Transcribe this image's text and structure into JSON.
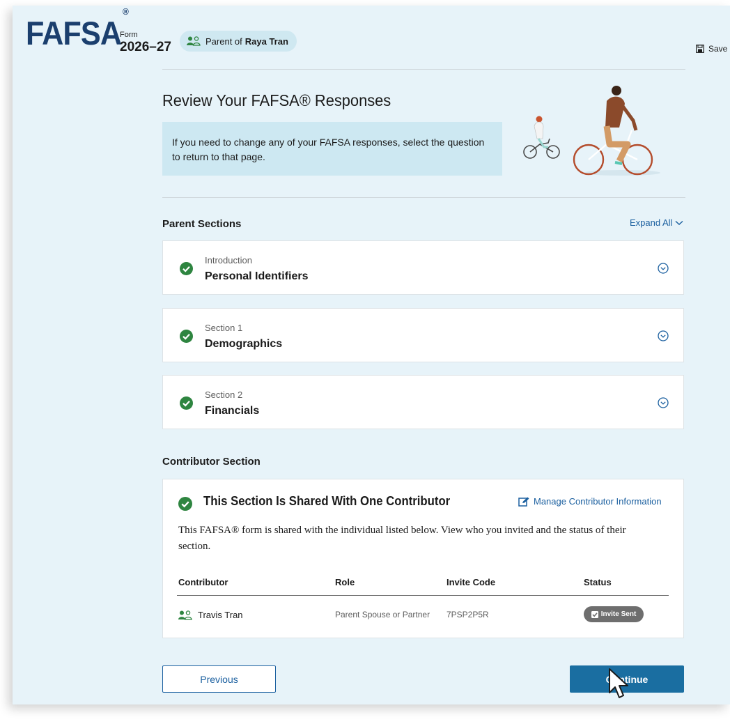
{
  "header": {
    "logo": "FAFSA",
    "logo_mark": "®",
    "form_label": "Form",
    "form_year": "2026–27",
    "role_prefix": "Parent of",
    "role_name": "Raya Tran",
    "save_label": "Save"
  },
  "main": {
    "title": "Review Your FAFSA® Responses",
    "info_text": "If you need to change any of your FAFSA responses, select the question to return to that page."
  },
  "parent_sections": {
    "heading": "Parent Sections",
    "expand_all": "Expand All",
    "items": [
      {
        "label": "Introduction",
        "title": "Personal Identifiers"
      },
      {
        "label": "Section 1",
        "title": "Demographics"
      },
      {
        "label": "Section 2",
        "title": "Financials"
      }
    ]
  },
  "contributor_section": {
    "heading": "Contributor Section",
    "card_title": "This Section Is Shared With One Contributor",
    "manage_link": "Manage Contributor Information",
    "description": "This FAFSA® form is shared with the individual listed below. View who you invited and the status of their section.",
    "table": {
      "columns": [
        "Contributor",
        "Role",
        "Invite Code",
        "Status"
      ],
      "rows": [
        {
          "name": "Travis Tran",
          "role": "Parent Spouse or Partner",
          "code": "7PSP2P5R",
          "status": "Invite Sent"
        }
      ]
    }
  },
  "footer": {
    "previous": "Previous",
    "continue": "Continue"
  },
  "colors": {
    "page_bg": "#e7f3f9",
    "brand_navy": "#1b3f6e",
    "link_blue": "#1a5f9f",
    "primary_button": "#1a6ea1",
    "success_green": "#2e8540",
    "info_bg": "#cde8f2",
    "badge_gray": "#6e6e6e"
  },
  "icons": {
    "role": "people-icon",
    "save": "save-icon",
    "check": "check-circle-icon",
    "chevron": "chevron-down-circle-icon",
    "edit": "edit-icon",
    "cursor": "mouse-pointer-icon"
  }
}
